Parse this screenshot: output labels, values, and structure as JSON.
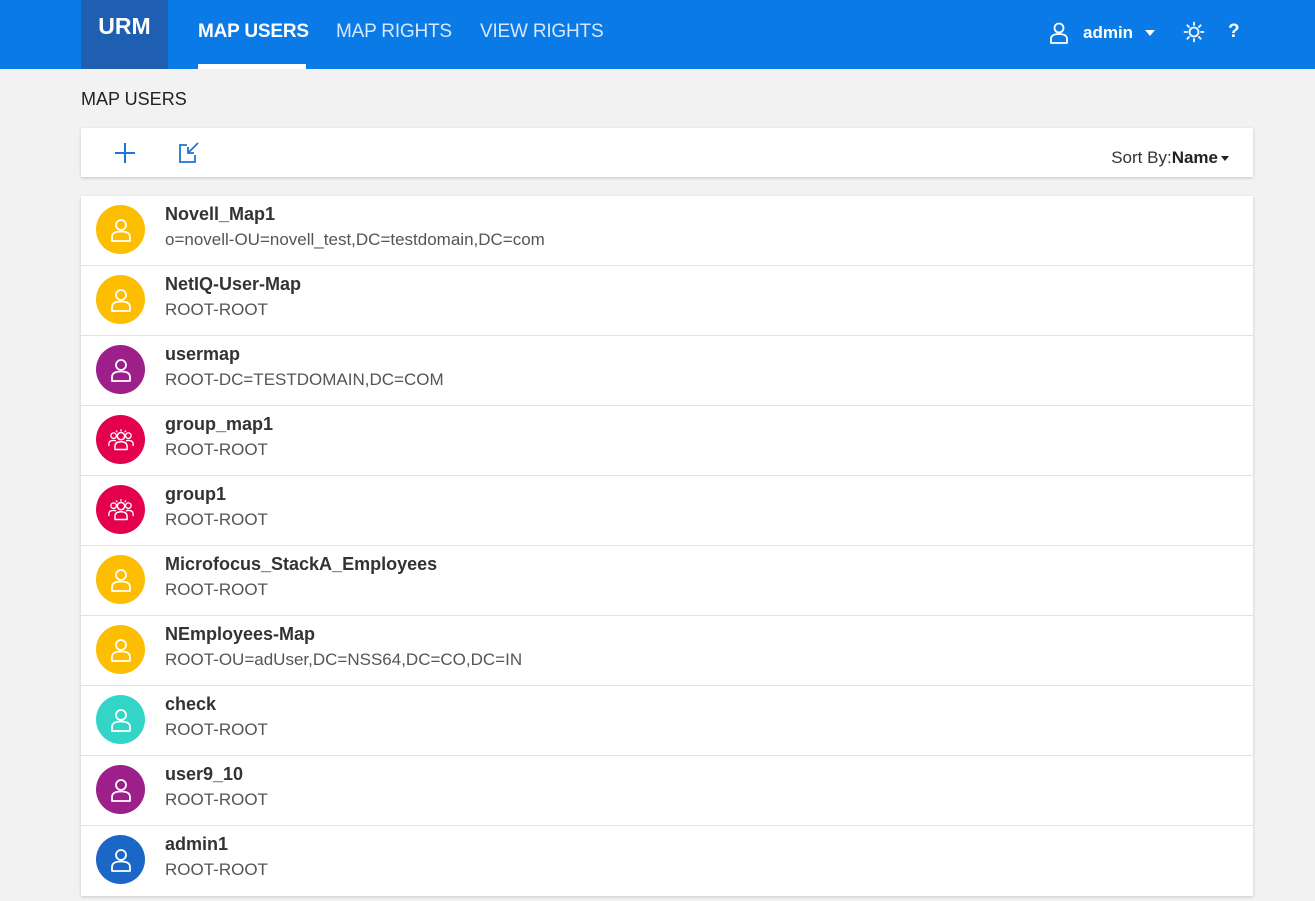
{
  "header": {
    "logo": "URM",
    "tabs": [
      {
        "label": "MAP USERS",
        "active": true
      },
      {
        "label": "MAP RIGHTS",
        "active": false
      },
      {
        "label": "VIEW RIGHTS",
        "active": false
      }
    ],
    "user": "admin",
    "help": "?"
  },
  "page": {
    "title": "MAP USERS"
  },
  "toolbar": {
    "sort_label": "Sort By:",
    "sort_value": "Name"
  },
  "colors": {
    "header_blue": "#0a7ae6",
    "logo_blue": "#1f5fb1",
    "yellow": "#fdbd00",
    "purple": "#9c1f8a",
    "red": "#e5004e",
    "teal": "#33d6c6",
    "blue": "#1a67c7"
  },
  "items": [
    {
      "name": "Novell_Map1",
      "dn": "o=novell-OU=novell_test,DC=testdomain,DC=com",
      "color": "#fdbd00",
      "icon": "user-icon"
    },
    {
      "name": "NetIQ-User-Map",
      "dn": "ROOT-ROOT",
      "color": "#fdbd00",
      "icon": "user-icon"
    },
    {
      "name": "usermap",
      "dn": "ROOT-DC=TESTDOMAIN,DC=COM",
      "color": "#9c1f8a",
      "icon": "user-icon"
    },
    {
      "name": "group_map1",
      "dn": "ROOT-ROOT",
      "color": "#e5004e",
      "icon": "group-icon"
    },
    {
      "name": "group1",
      "dn": "ROOT-ROOT",
      "color": "#e5004e",
      "icon": "group-icon"
    },
    {
      "name": "Microfocus_StackA_Employees",
      "dn": "ROOT-ROOT",
      "color": "#fdbd00",
      "icon": "user-icon"
    },
    {
      "name": "NEmployees-Map",
      "dn": "ROOT-OU=adUser,DC=NSS64,DC=CO,DC=IN",
      "color": "#fdbd00",
      "icon": "user-icon"
    },
    {
      "name": "check",
      "dn": "ROOT-ROOT",
      "color": "#33d6c6",
      "icon": "user-icon"
    },
    {
      "name": "user9_10",
      "dn": "ROOT-ROOT",
      "color": "#9c1f8a",
      "icon": "user-icon"
    },
    {
      "name": "admin1",
      "dn": "ROOT-ROOT",
      "color": "#1a67c7",
      "icon": "user-icon"
    }
  ]
}
